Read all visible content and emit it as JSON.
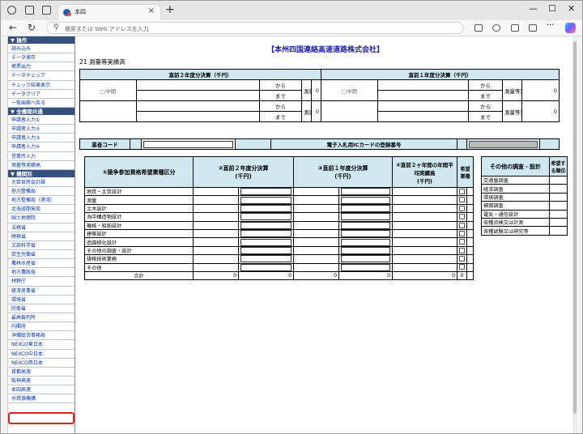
{
  "browser": {
    "tab_title": "本四",
    "address_placeholder": "検索または Web アドレスを入力"
  },
  "sidebar": {
    "sections": [
      {
        "title": "▼ 操作",
        "items": [
          "読み込み",
          "データ保存",
          "帳票出力",
          "データチェック",
          "チェック結果表示",
          "データクリア",
          "一覧画面へ戻る"
        ]
      },
      {
        "title": "▼ 全機関共通",
        "items": [
          "申請者入力①",
          "申請者入力②",
          "申請者入力③",
          "申請者入力④",
          "営業所入力",
          "測量等実績高"
        ]
      },
      {
        "title": "▼ 機関別",
        "items": [
          "大臣官房会計課",
          "地方整備局",
          "地方整備局（港湾）",
          "北海道開発局",
          "国土地理院",
          "法務省",
          "財務省",
          "文部科学省",
          "厚生労働省",
          "農林水産省",
          "地方農政局",
          "林野庁",
          "経済産業省",
          "環境省",
          "防衛省",
          "最高裁判所",
          "内閣府",
          "沖縄総合事務局",
          "NEXCO東日本",
          "NEXCO中日本",
          "NEXCO西日本",
          "首都高速",
          "阪神高速",
          "本四高速",
          "水資源機構"
        ]
      }
    ]
  },
  "main": {
    "company_title": "【本州四国連絡高速道路株式会社】",
    "section_title": "21 測量等実績高",
    "fy2_header": "直前２年度分決算（千円）",
    "fy1_header": "直前１年度分決算（千円）",
    "interim": "□中間",
    "from": "から",
    "to": "まで",
    "record_label": "測量等実績高",
    "record_value": "0",
    "trader_code_label": "業者コード",
    "ic_card_label": "電子入札用ICカードの登録番号",
    "tbl": {
      "h1": "①競争参加資格希望業種区分",
      "h2": "②直前２年度分決算\n(千円)",
      "h3": "③直前１年度分決算\n(千円)",
      "h4": "④直前２ヶ年間の年間平均実績高\n(千円)",
      "h5": "希望業種",
      "rows": [
        "地質・土質設計",
        "測量",
        "土木設計",
        "海中構造物設計",
        "機械・船舶設計",
        "建築設計",
        "造園緑化設計",
        "その他の調査・設計",
        "規格技術業務",
        "その他"
      ],
      "total_label": "合計",
      "total": [
        "0",
        "0",
        "0",
        "0",
        "0"
      ]
    },
    "other": {
      "h1": "その他の調査・設計",
      "h2": "希望する順位",
      "rows": [
        "交通量調査",
        "経済調査",
        "環境調査",
        "補償調査",
        "電気・通信設計",
        "各種点検又は計測",
        "各種試験又は研究等"
      ]
    }
  }
}
